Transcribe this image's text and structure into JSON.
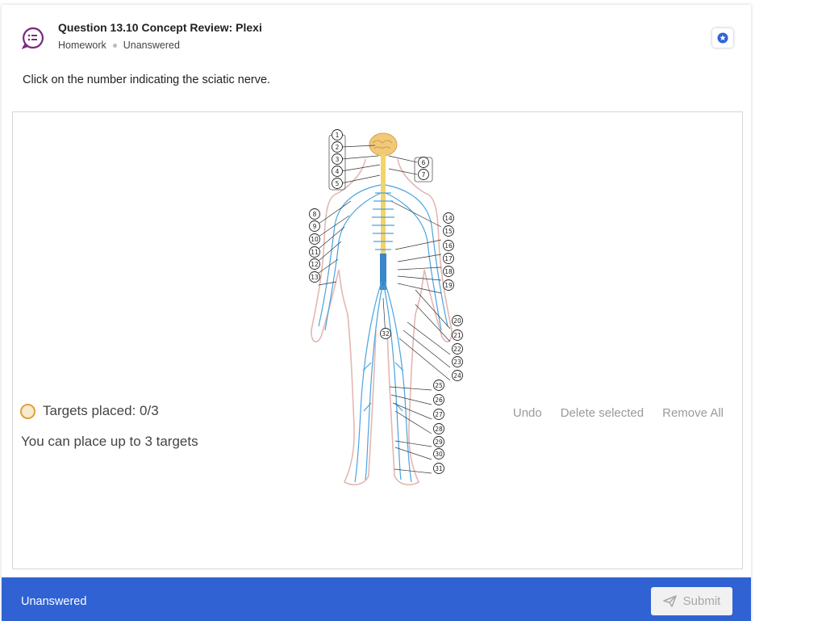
{
  "header": {
    "title": "Question 13.10 Concept Review: Plexi",
    "type": "Homework",
    "status": "Unanswered"
  },
  "prompt": "Click on the number indicating the sciatic nerve.",
  "diagram": {
    "labels": [
      "1",
      "2",
      "3",
      "4",
      "5",
      "6",
      "7",
      "8",
      "9",
      "10",
      "11",
      "12",
      "13",
      "14",
      "15",
      "16",
      "17",
      "18",
      "19",
      "20",
      "21",
      "22",
      "23",
      "24",
      "25",
      "26",
      "27",
      "28",
      "29",
      "30",
      "31",
      "32"
    ]
  },
  "targets": {
    "placed_text": "Targets placed: 0/3",
    "limit_text": "You can place up to 3 targets"
  },
  "actions": {
    "undo": "Undo",
    "delete_selected": "Delete selected",
    "remove_all": "Remove All"
  },
  "footer": {
    "status": "Unanswered",
    "submit": "Submit"
  },
  "colors": {
    "accent": "#3062d4",
    "nerve": "#4aa3df",
    "brain": "#f0c97a",
    "icon": "#7a2a7e"
  }
}
